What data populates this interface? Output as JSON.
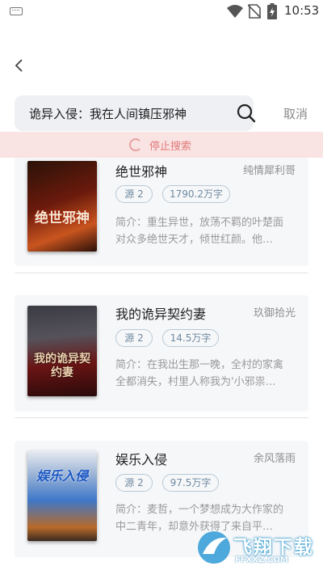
{
  "status_bar": {
    "time": "10:53",
    "icons": [
      "keyboard-icon",
      "wifi-icon",
      "no-sim-icon",
      "battery-charging-icon"
    ]
  },
  "header": {
    "back_icon": "chevron-left-icon"
  },
  "search": {
    "query": "诡异入侵：我在人间镇压邪神",
    "icon": "search-icon",
    "cancel_label": "取消"
  },
  "stop_bar": {
    "label": "停止搜索",
    "icon": "loading-spinner-icon"
  },
  "results": [
    {
      "title": "绝世邪神",
      "author": "纯情犀利哥",
      "source": "源 2",
      "word_count": "1790.2万字",
      "description": "简介：重生异世，放荡不羁的叶楚面对众多绝世天才，倾世红颜。他…",
      "cover_title": "绝世邪神",
      "cover_colors": [
        "#2a1208",
        "#8b1e0e",
        "#c9551f"
      ]
    },
    {
      "title": "我的诡异契约妻",
      "author": "玖御拾光",
      "source": "源 2",
      "word_count": "14.5万字",
      "description": "简介：在我出生那一晚，全村的家禽全都消失，村里人称我为'小邪祟…",
      "cover_title": "我的诡异契约妻",
      "cover_colors": [
        "#3b3b44",
        "#6a1414",
        "#2a0a0a"
      ]
    },
    {
      "title": "娱乐入侵",
      "author": "余风落雨",
      "source": "源 2",
      "word_count": "97.5万字",
      "description": "简介：麦哲，一个梦想成为大作家的中二青年，却意外获得了来自平…",
      "cover_title": "娱乐入侵",
      "cover_colors": [
        "#0f3d8a",
        "#3f78c9",
        "#b86a2a"
      ]
    }
  ],
  "watermark": {
    "text": "飞翔下载",
    "url": "FFXXZ.COM"
  }
}
